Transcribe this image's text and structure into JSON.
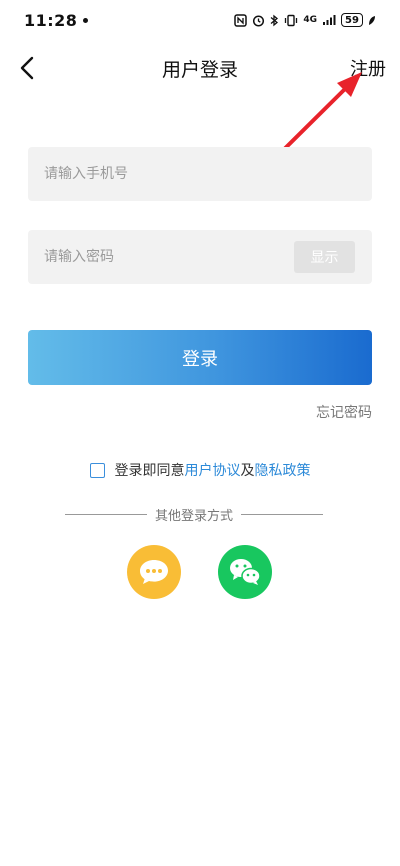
{
  "status_bar": {
    "time": "11:28",
    "network": "4G",
    "battery": "59"
  },
  "nav": {
    "title": "用户登录",
    "register_label": "注册"
  },
  "form": {
    "phone_placeholder": "请输入手机号",
    "password_placeholder": "请输入密码",
    "show_password_label": "显示",
    "login_label": "登录",
    "forgot_password_label": "忘记密码"
  },
  "agreement": {
    "prefix": "登录即同意",
    "user_agreement": "用户协议",
    "conjunction": "及",
    "privacy_policy": "隐私政策",
    "checked": false
  },
  "other_login": {
    "label": "其他登录方式",
    "methods": [
      {
        "icon": "chat-bubble-icon",
        "color": "#f9bd36"
      },
      {
        "icon": "wechat-icon",
        "color": "#18c75f"
      }
    ]
  },
  "colors": {
    "accent": "#2d8ad8",
    "annotation_arrow": "#e8232b"
  }
}
